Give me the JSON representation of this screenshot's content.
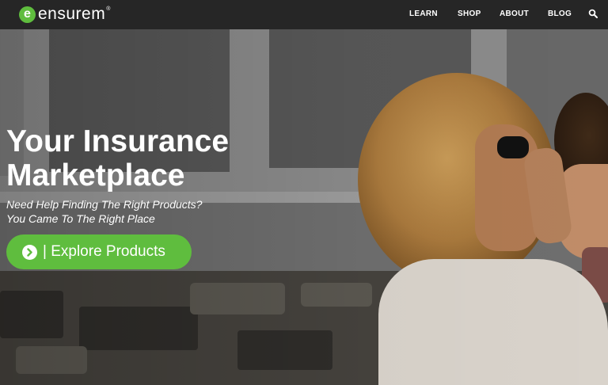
{
  "brand": {
    "logo_letter": "e",
    "name": "ensurem",
    "reg_mark": "®",
    "accent_color": "#5fbd3e"
  },
  "nav": {
    "items": [
      {
        "label": "LEARN"
      },
      {
        "label": "SHOP"
      },
      {
        "label": "ABOUT"
      },
      {
        "label": "BLOG"
      }
    ],
    "search_icon": "search-icon"
  },
  "hero": {
    "headline_line1": "Your Insurance",
    "headline_line2": "Marketplace",
    "subtitle_line1": "Need Help Finding The Right Products?",
    "subtitle_line2": "You Came To The Right Place",
    "cta_label": "| Explore Products",
    "cta_icon": "chevron-right-circle-icon"
  }
}
